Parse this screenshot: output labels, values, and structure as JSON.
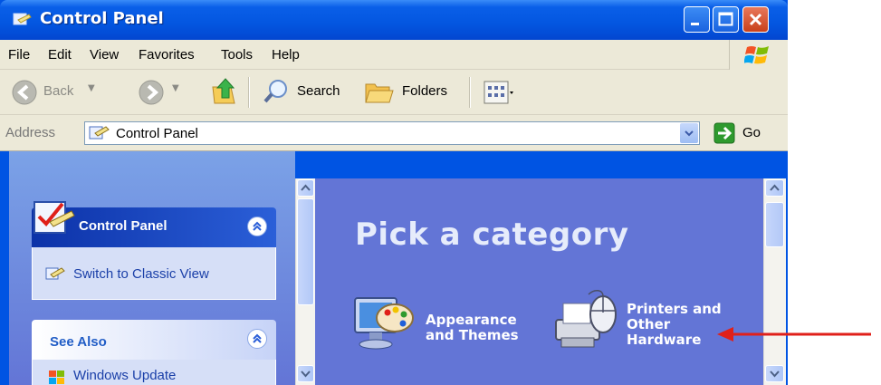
{
  "window": {
    "title": "Control Panel"
  },
  "menu": {
    "items": [
      "File",
      "Edit",
      "View",
      "Favorites",
      "Tools",
      "Help"
    ]
  },
  "toolbar": {
    "back_label": "Back",
    "search_label": "Search",
    "folders_label": "Folders"
  },
  "address": {
    "label": "Address",
    "value": "Control Panel",
    "go_label": "Go"
  },
  "taskpane": {
    "control_panel": {
      "title": "Control Panel",
      "link": "Switch to Classic View"
    },
    "see_also": {
      "title": "See Also",
      "link": "Windows Update"
    }
  },
  "main": {
    "heading": "Pick a category",
    "categories": [
      {
        "label_line1": "Appearance",
        "label_line2": "and Themes"
      },
      {
        "label_line1": "Printers and",
        "label_line2": "Other",
        "label_line3": "Hardware"
      }
    ]
  },
  "colors": {
    "titlebar": "#0a5fe8",
    "taskpane_bg": "#7ba2e7",
    "main_bg": "#6375d6",
    "annotation_arrow": "#e0201a"
  },
  "icons": [
    "control-panel-icon",
    "windows-logo-icon",
    "back-arrow-icon",
    "forward-arrow-icon",
    "up-folder-icon",
    "search-icon",
    "folders-icon",
    "views-icon",
    "go-arrow-icon",
    "appearance-themes-icon",
    "printers-hardware-icon"
  ]
}
